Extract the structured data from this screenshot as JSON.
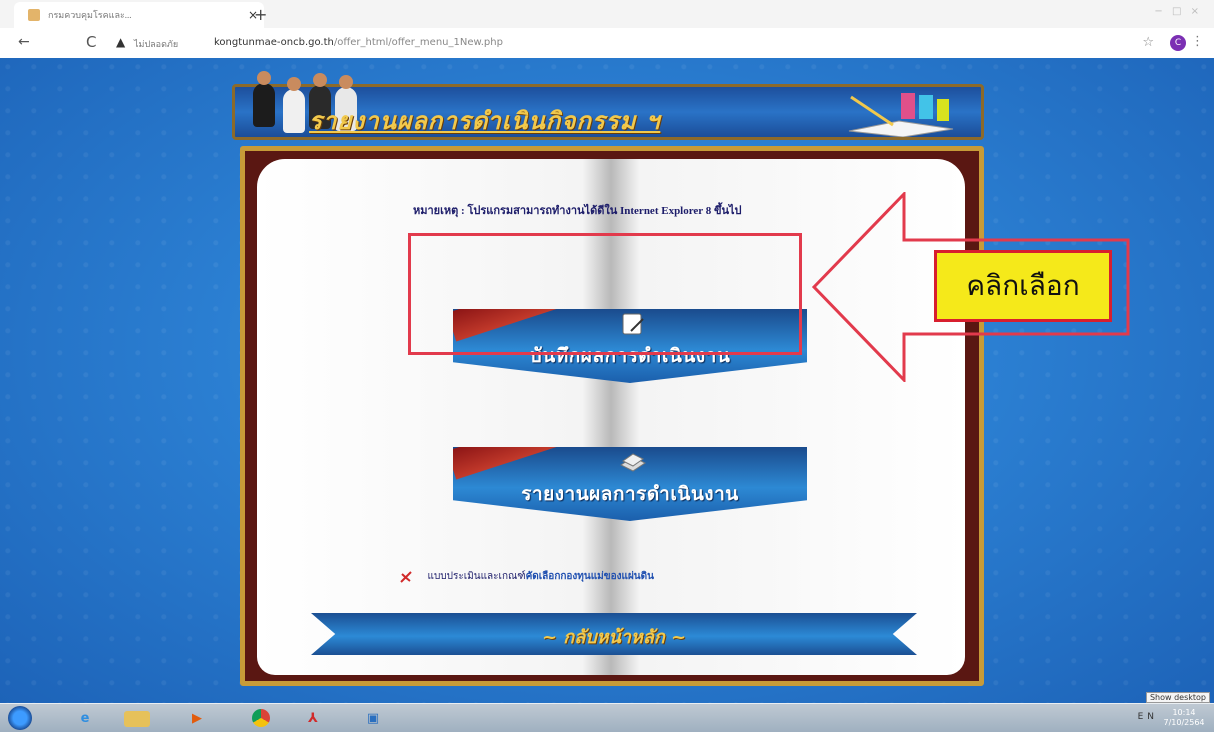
{
  "browser": {
    "tab_title": "กรมควบคุมโรคและ...",
    "tab_close": "×",
    "new_tab": "+",
    "window_controls": "− □ ×",
    "back": "←",
    "reload": "C",
    "security_icon": "warning-icon",
    "security_label": "ไม่ปลอดภัย",
    "url_domain": "kongtunmae-oncb.go.th",
    "url_path": "/offer_html/offer_menu_1New.php",
    "profile_initial": "C"
  },
  "page": {
    "banner_title": "รายงานผลการดำเนินกิจกรรม ฯ",
    "note": "หมายเหตุ : โปรแกรมสามารถทำงานได้ดีใน Internet Explorer 8 ขึ้นไป",
    "menu": {
      "record_label": "บันทึกผลการดำเนินงาน",
      "report_label": "รายงานผลการดำเนินงาน"
    },
    "pdf_link_prefix": "แบบประเมินและเกณฑ์",
    "pdf_link_highlight": "คัดเลือกกองทุนแม่ของแผ่นดิน",
    "back_home": "~ กลับหน้าหลัก ~"
  },
  "annotation": {
    "callout_label": "คลิกเลือก",
    "highlight_color": "#e23a4c",
    "callout_bg": "#f5e91a"
  },
  "taskbar": {
    "tray_lang": "EN",
    "clock_time": "10:14",
    "clock_date": "7/10/2564",
    "show_desktop": "Show desktop"
  }
}
